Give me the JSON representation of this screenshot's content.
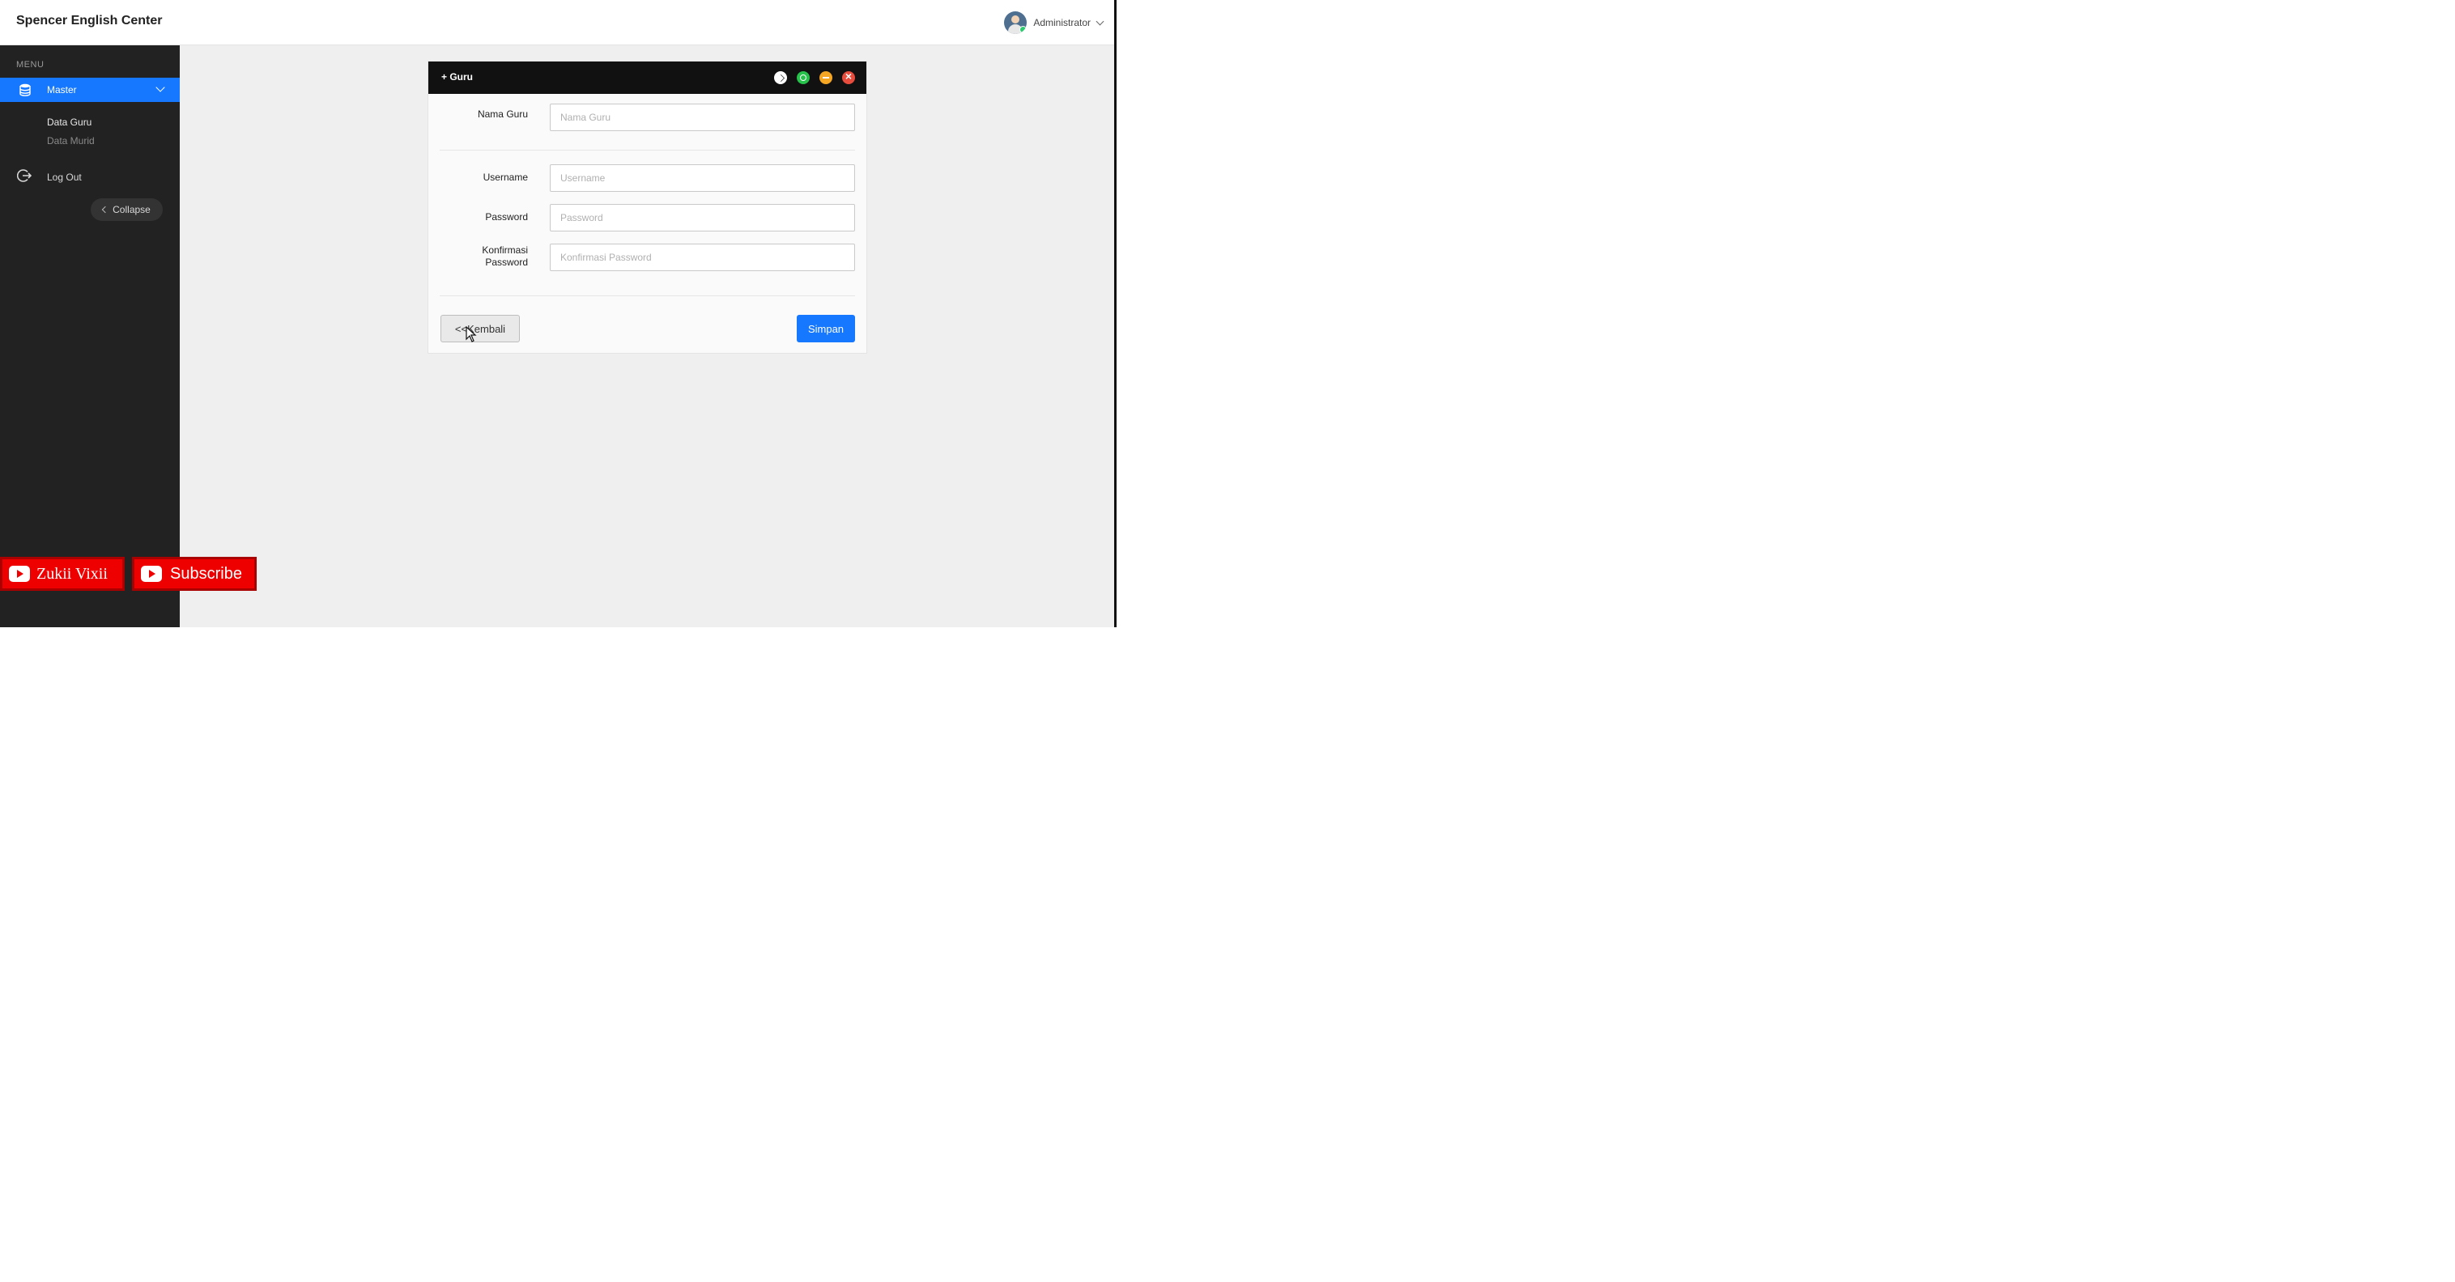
{
  "header": {
    "brand": "Spencer English Center",
    "user_name": "Administrator",
    "avatar_icon": "user-avatar"
  },
  "sidebar": {
    "heading": "MENU",
    "master_label": "Master",
    "items": [
      {
        "label": "Data Guru",
        "active": true
      },
      {
        "label": "Data Murid",
        "active": false
      }
    ],
    "logout_label": "Log Out",
    "collapse_label": "Collapse"
  },
  "watermark": {
    "channel": "Zukii Vixii",
    "subscribe": "Subscribe"
  },
  "panel": {
    "title": "+ Guru",
    "header_icons": [
      "check-icon",
      "refresh-icon",
      "minimize-icon",
      "close-icon"
    ],
    "fields": {
      "nama_guru": {
        "label": "Nama Guru",
        "placeholder": "Nama Guru",
        "value": ""
      },
      "username": {
        "label": "Username",
        "placeholder": "Username",
        "value": ""
      },
      "password": {
        "label": "Password",
        "placeholder": "Password",
        "value": ""
      },
      "konfirmasi_line1": "Konfirmasi",
      "konfirmasi_line2": "Password",
      "konfirmasi": {
        "placeholder": "Konfirmasi Password",
        "value": ""
      }
    },
    "back_label": "<<Kembali",
    "save_label": "Simpan"
  },
  "colors": {
    "accent": "#1677ff",
    "sidebar_bg": "#222222",
    "panel_header_bg": "#111111",
    "youtube_red": "#ee0000"
  }
}
